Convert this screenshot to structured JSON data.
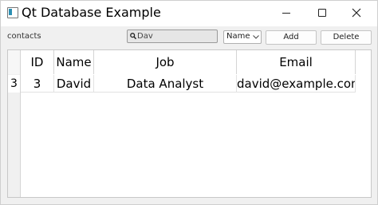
{
  "window": {
    "title": "Qt Database Example"
  },
  "toolbar": {
    "connection_label": "contacts",
    "search_value": "Dav",
    "filter_selected": "Name",
    "add_label": "Add",
    "delete_label": "Delete"
  },
  "table": {
    "columns": [
      "ID",
      "Name",
      "Job",
      "Email"
    ],
    "rows": [
      {
        "row_header": "3",
        "cells": [
          "3",
          "David",
          "Data Analyst",
          "david@example.com"
        ]
      }
    ]
  }
}
